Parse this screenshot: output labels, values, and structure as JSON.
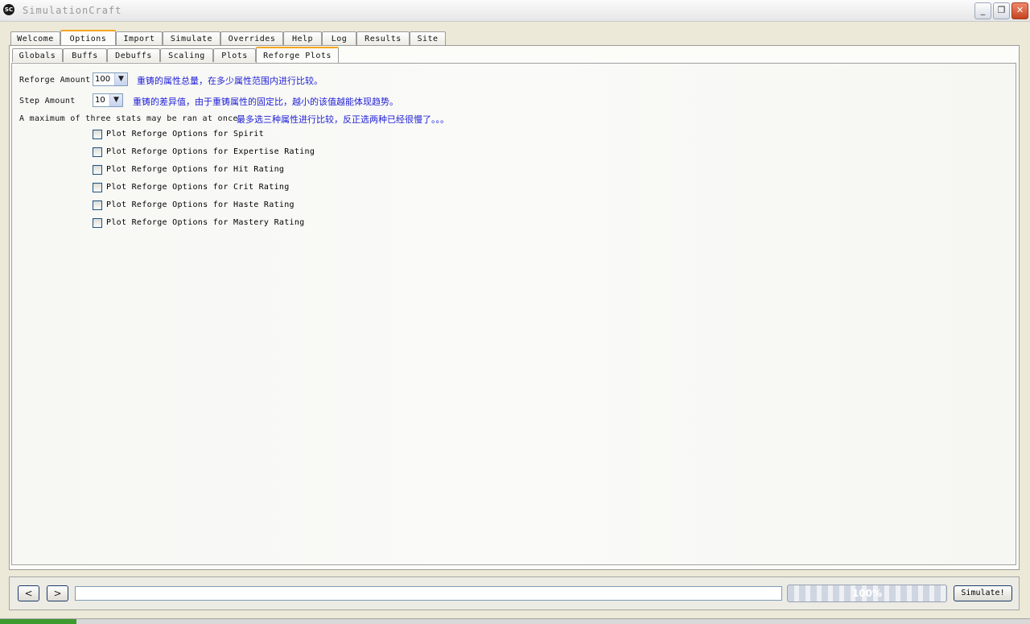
{
  "window": {
    "title": "SimulationCraft",
    "icon_text": "SC",
    "controls": {
      "minimize": "_",
      "restore": "❐",
      "close": "✕"
    }
  },
  "main_tabs": [
    {
      "label": "Welcome"
    },
    {
      "label": "Options",
      "active": true
    },
    {
      "label": "Import"
    },
    {
      "label": "Simulate"
    },
    {
      "label": "Overrides"
    },
    {
      "label": "Help"
    },
    {
      "label": "Log"
    },
    {
      "label": "Results"
    },
    {
      "label": "Site"
    }
  ],
  "sub_tabs": [
    {
      "label": "Globals"
    },
    {
      "label": "Buffs"
    },
    {
      "label": "Debuffs"
    },
    {
      "label": "Scaling"
    },
    {
      "label": "Plots"
    },
    {
      "label": "Reforge Plots",
      "active": true
    }
  ],
  "reforge": {
    "amount_label": "Reforge Amount",
    "amount_value": "100",
    "amount_note": "重铸的属性总量，在多少属性范围内进行比较。",
    "step_label": "Step Amount",
    "step_value": "10",
    "step_note": "重铸的差异值，由于重铸属性的固定比，越小的该值越能体现趋势。",
    "max_text": "A maximum of three stats may be ran at once.",
    "max_note": "最多选三种属性进行比较，反正选两种已经很慢了。。。",
    "options": [
      {
        "label": "Plot Reforge Options for Spirit",
        "checked": false
      },
      {
        "label": "Plot Reforge Options for Expertise Rating",
        "checked": false
      },
      {
        "label": "Plot Reforge Options for Hit Rating",
        "checked": false
      },
      {
        "label": "Plot Reforge Options for Crit Rating",
        "checked": false
      },
      {
        "label": "Plot Reforge Options for Haste Rating",
        "checked": false
      },
      {
        "label": "Plot Reforge Options for Mastery Rating",
        "checked": false
      }
    ]
  },
  "bottom_bar": {
    "back": "<",
    "forward": ">",
    "url_value": "",
    "progress": "100%",
    "simulate_label": "Simulate!"
  }
}
